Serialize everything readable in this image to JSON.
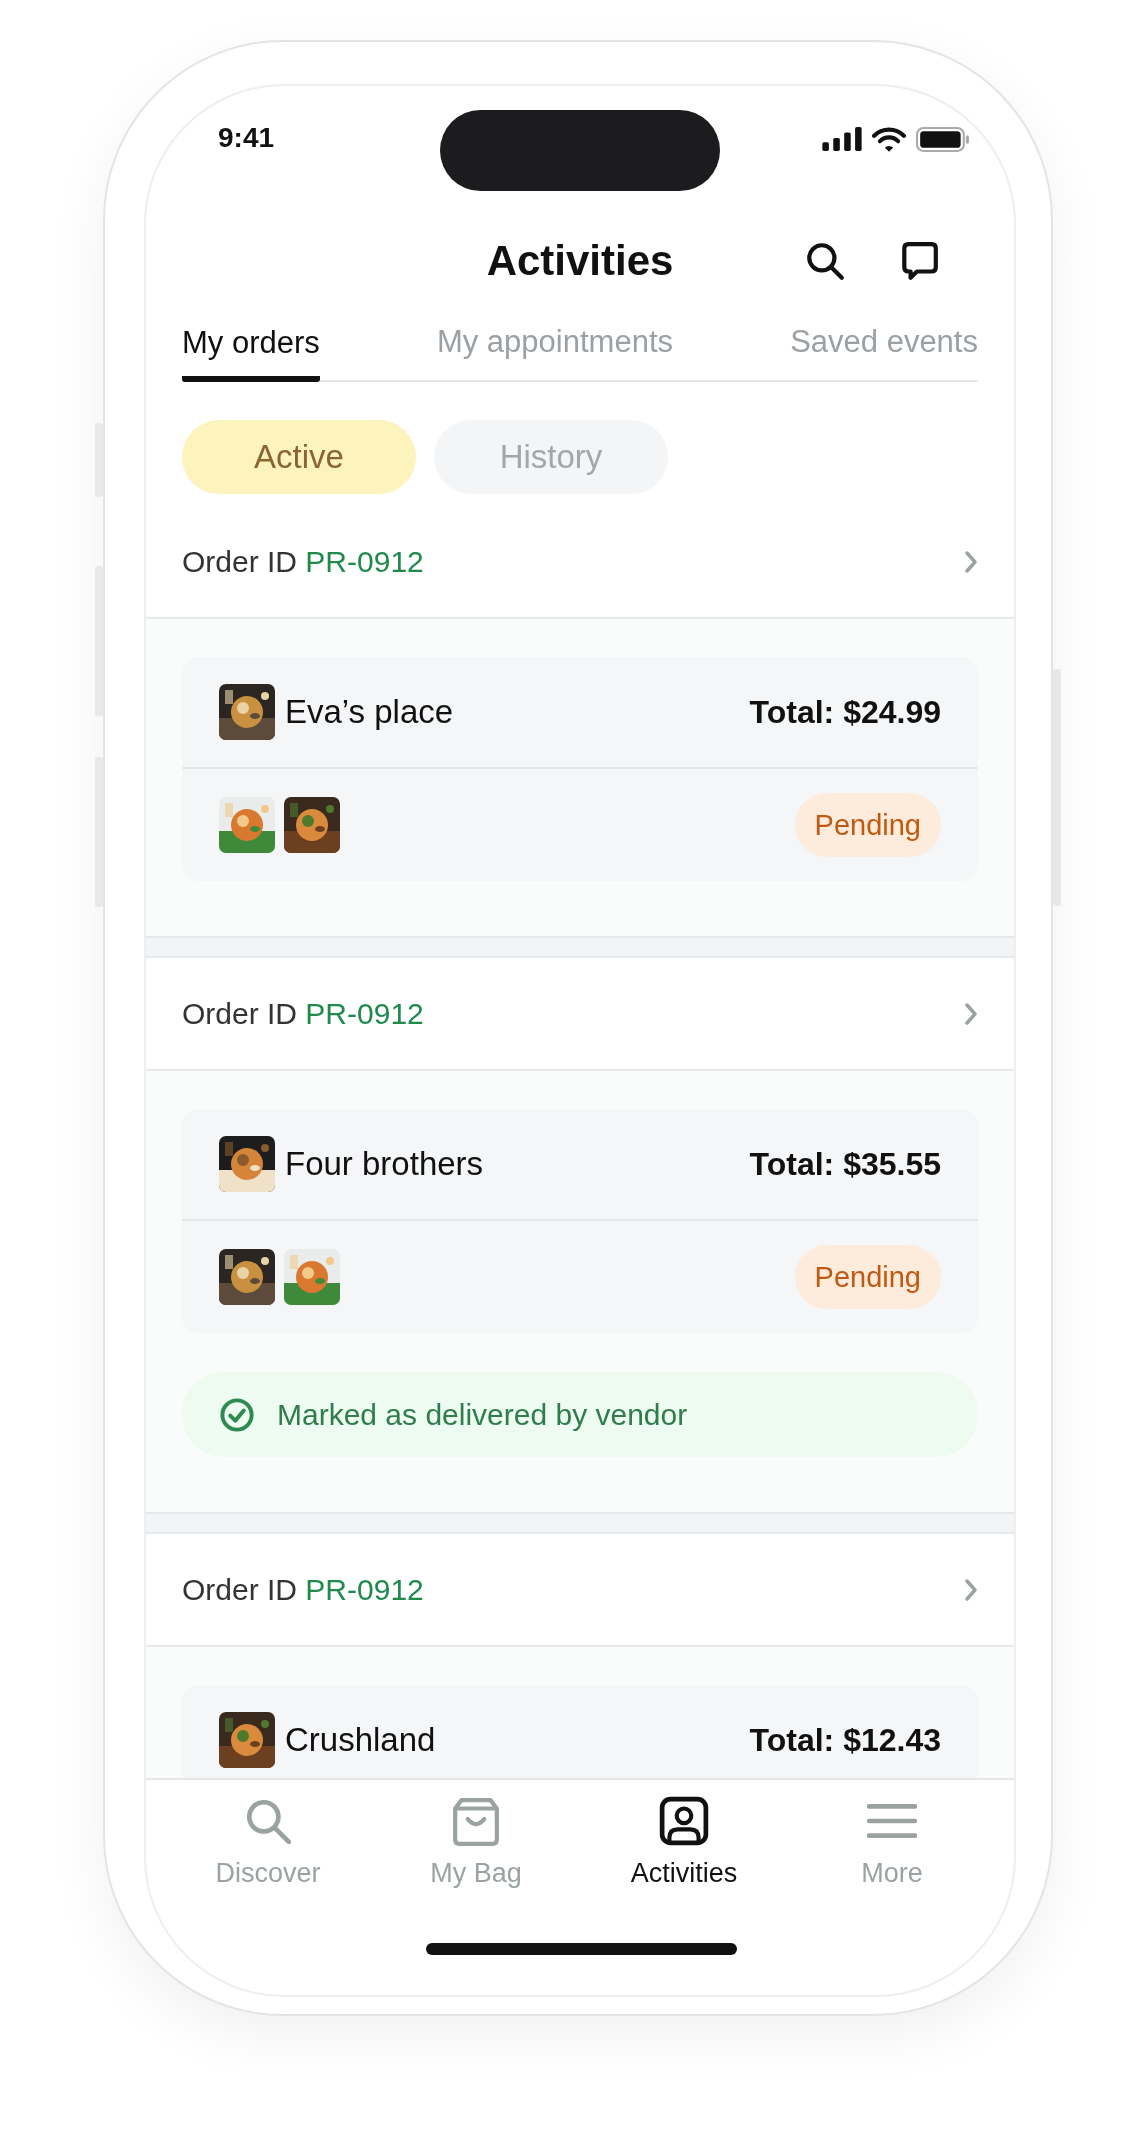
{
  "status_bar": {
    "time": "9:41"
  },
  "header": {
    "title": "Activities"
  },
  "tabs": [
    {
      "label": "My orders",
      "selected": true
    },
    {
      "label": "My appointments",
      "selected": false
    },
    {
      "label": "Saved events",
      "selected": false
    }
  ],
  "filters": [
    {
      "label": "Active",
      "selected": true
    },
    {
      "label": "History",
      "selected": false
    }
  ],
  "orders": [
    {
      "id_label": "Order ID",
      "id": "PR-0912",
      "vendor": "Eva’s place",
      "total": "Total: $24.99",
      "status": "Pending"
    },
    {
      "id_label": "Order ID",
      "id": "PR-0912",
      "vendor": "Four brothers",
      "total": "Total: $35.55",
      "status": "Pending",
      "note": "Marked as delivered by vendor"
    },
    {
      "id_label": "Order ID",
      "id": "PR-0912",
      "vendor": "Crushland",
      "total": "Total: $12.43"
    }
  ],
  "bottom_nav": [
    {
      "label": "Discover",
      "kind": "search",
      "selected": false
    },
    {
      "label": "My Bag",
      "kind": "bag",
      "selected": false
    },
    {
      "label": "Activities",
      "kind": "profile",
      "selected": true
    },
    {
      "label": "More",
      "kind": "menu",
      "selected": false
    }
  ]
}
